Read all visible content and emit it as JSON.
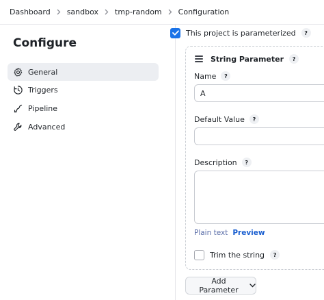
{
  "breadcrumb": {
    "items": [
      "Dashboard",
      "sandbox",
      "tmp-random",
      "Configuration"
    ]
  },
  "sidebar": {
    "title": "Configure",
    "items": [
      {
        "label": "General",
        "icon": "gear-icon",
        "active": true
      },
      {
        "label": "Triggers",
        "icon": "clock-icon",
        "active": false
      },
      {
        "label": "Pipeline",
        "icon": "pipeline-icon",
        "active": false
      },
      {
        "label": "Advanced",
        "icon": "wrench-icon",
        "active": false
      }
    ]
  },
  "main": {
    "parameterized_label": "This project is parameterized",
    "parameterized_checked": true,
    "help_glyph": "?",
    "parameter": {
      "title": "String Parameter",
      "name_label": "Name",
      "name_value": "A",
      "default_label": "Default Value",
      "default_value": "",
      "description_label": "Description",
      "description_value": "",
      "plain_text": "Plain text",
      "preview": "Preview",
      "trim_label": "Trim the string",
      "trim_checked": false
    },
    "add_parameter": "Add Parameter"
  },
  "colors": {
    "accent": "#1a73e8",
    "link": "#1a5fd0",
    "active_bg": "#eceef2"
  }
}
